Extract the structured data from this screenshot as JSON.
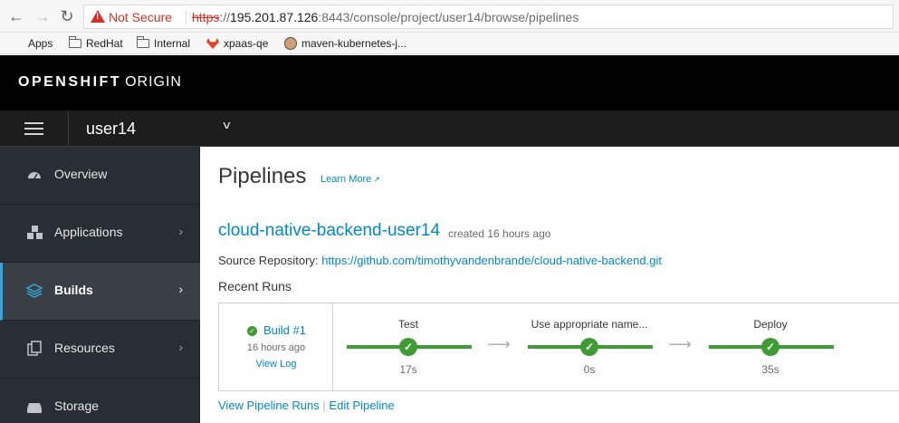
{
  "browser": {
    "not_secure": "Not Secure",
    "url_scheme": "https",
    "url_rest_prefix": "://",
    "url_host": "195.201.87.126",
    "url_path": ":8443/console/project/user14/browse/pipelines",
    "bookmarks": [
      {
        "label": "Apps",
        "icon": "apps-grid-icon"
      },
      {
        "label": "RedHat",
        "icon": "folder-icon"
      },
      {
        "label": "Internal",
        "icon": "folder-icon"
      },
      {
        "label": "xpaas-qe",
        "icon": "gitlab-icon"
      },
      {
        "label": "maven-kubernetes-j...",
        "icon": "avatar-icon"
      }
    ]
  },
  "masthead": {
    "brand_bold": "OPENSHIFT",
    "brand_light": "ORIGIN"
  },
  "project": {
    "name": "user14"
  },
  "sidebar": {
    "items": [
      {
        "label": "Overview",
        "icon": "dashboard-icon",
        "active": false,
        "has_chevron": false
      },
      {
        "label": "Applications",
        "icon": "cubes-icon",
        "active": false,
        "has_chevron": true
      },
      {
        "label": "Builds",
        "icon": "layers-icon",
        "active": true,
        "has_chevron": true
      },
      {
        "label": "Resources",
        "icon": "files-icon",
        "active": false,
        "has_chevron": true
      },
      {
        "label": "Storage",
        "icon": "hdd-icon",
        "active": false,
        "has_chevron": false
      }
    ]
  },
  "main": {
    "title": "Pipelines",
    "learn_more": "Learn More",
    "pipeline": {
      "name": "cloud-native-backend-user14",
      "created": "created 16 hours ago",
      "source_label": "Source Repository:",
      "source_url": "https://github.com/timothyvandenbrande/cloud-native-backend.git",
      "recent_runs_label": "Recent Runs",
      "run": {
        "build_label": "Build #1",
        "time": "16 hours ago",
        "view_log": "View Log",
        "stages": [
          {
            "name": "Test",
            "duration": "17s",
            "status": "complete"
          },
          {
            "name": "Use appropriate name...",
            "duration": "0s",
            "status": "complete"
          },
          {
            "name": "Deploy",
            "duration": "35s",
            "status": "complete"
          }
        ]
      },
      "view_runs": "View Pipeline Runs",
      "link_separator": "|",
      "edit_pipeline": "Edit Pipeline"
    }
  },
  "colors": {
    "link": "#0088ce",
    "success": "#3f9c35",
    "nav_active": "#39a5dc",
    "sidebar_bg": "#292e34"
  }
}
